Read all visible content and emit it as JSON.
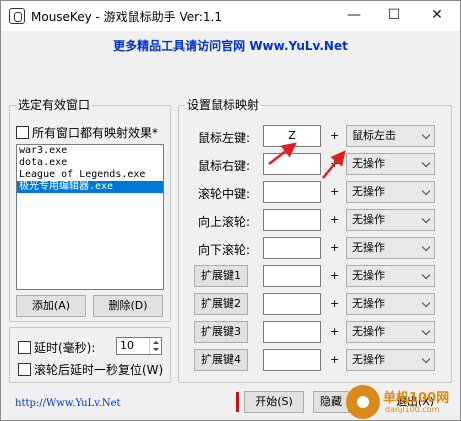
{
  "window": {
    "title": "MouseKey - 游戏鼠标助手 Ver:1.1",
    "minimize": "—",
    "maximize": "☐",
    "close": "✕"
  },
  "banner": {
    "text": "更多精品工具请访问官网 Www.YuLv.Net"
  },
  "left_group": {
    "legend": "选定有效窗口",
    "all_windows_label": "所有窗口都有映射效果*",
    "list": [
      "war3.exe",
      "dota.exe",
      "League of Legends.exe",
      "极光专用编辑器.exe"
    ],
    "selected_index": 3,
    "add_button": "添加(A)",
    "delete_button": "删除(D)"
  },
  "delay_group": {
    "delay_label": "延时(毫秒):",
    "delay_value": "10",
    "reset_label": "滚轮后延时一秒复位(W)"
  },
  "right_group": {
    "legend": "设置鼠标映射",
    "rows": [
      {
        "label": "鼠标左键:",
        "is_button": false,
        "key": "Z",
        "action": "鼠标左击"
      },
      {
        "label": "鼠标右键:",
        "is_button": false,
        "key": "",
        "action": "无操作"
      },
      {
        "label": "滚轮中键:",
        "is_button": false,
        "key": "",
        "action": "无操作"
      },
      {
        "label": "向上滚轮:",
        "is_button": false,
        "key": "",
        "action": "无操作"
      },
      {
        "label": "向下滚轮:",
        "is_button": false,
        "key": "",
        "action": "无操作"
      },
      {
        "label": "扩展键1",
        "is_button": true,
        "key": "",
        "action": "无操作"
      },
      {
        "label": "扩展键2",
        "is_button": true,
        "key": "",
        "action": "无操作"
      },
      {
        "label": "扩展键3",
        "is_button": true,
        "key": "",
        "action": "无操作"
      },
      {
        "label": "扩展键4",
        "is_button": true,
        "key": "",
        "action": "无操作"
      }
    ],
    "plus": "+"
  },
  "footer": {
    "link": "http://Www.YuLv.Net",
    "start_button": "开始(S)",
    "hide_button": "隐藏",
    "exit_button": "退出(X)"
  },
  "watermark": {
    "text": "单机100网",
    "sub": "danji100.com"
  },
  "colors": {
    "link": "#0033cc",
    "selection": "#0078d7",
    "annotation_arrow": "#e02020",
    "red_bar": "#d01010"
  }
}
